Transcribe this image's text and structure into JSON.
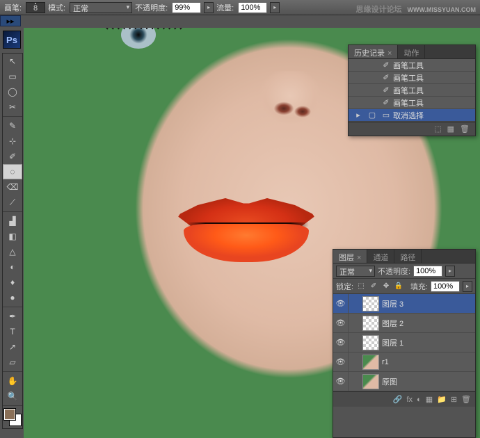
{
  "topbar": {
    "brush_label": "画笔:",
    "brush_size": "8",
    "mode_label": "模式:",
    "mode_value": "正常",
    "opacity_label": "不透明度:",
    "opacity_value": "99%",
    "flow_label": "流量:",
    "flow_value": "100%"
  },
  "watermark": {
    "main": "思缘设计论坛",
    "sub": "WWW.MISSYUAN.COM"
  },
  "ps_logo": "Ps",
  "tools": [
    "↖",
    "▭",
    "◯",
    "✂",
    "✎",
    "⊹",
    "✐",
    "◌",
    "⌫",
    "⟋",
    "▟",
    "◧",
    "△",
    "◐",
    "♦",
    "●",
    "✒",
    "T",
    "↗",
    "▱",
    "✋",
    "🔍"
  ],
  "selected_tool_index": 7,
  "swatch": {
    "fg": "#8a7058",
    "bg": "#ffffff"
  },
  "history": {
    "tabs": [
      "历史记录",
      "动作"
    ],
    "rows": [
      {
        "icon": "brush",
        "label": "画笔工具"
      },
      {
        "icon": "brush",
        "label": "画笔工具"
      },
      {
        "icon": "brush",
        "label": "画笔工具"
      },
      {
        "icon": "brush",
        "label": "画笔工具"
      },
      {
        "icon": "deselect",
        "label": "取消选择",
        "selected": true
      }
    ],
    "footer_icons": [
      "⬚",
      "▦",
      "🗑"
    ]
  },
  "layers": {
    "tabs": [
      "图层",
      "通道",
      "路径"
    ],
    "blend_mode": "正常",
    "opacity_label": "不透明度:",
    "opacity_value": "100%",
    "lock_label": "锁定:",
    "fill_label": "填充:",
    "fill_value": "100%",
    "rows": [
      {
        "name": "图层 3",
        "thumb": "checker",
        "selected": true
      },
      {
        "name": "图层 2",
        "thumb": "checker"
      },
      {
        "name": "图层 1",
        "thumb": "checker"
      },
      {
        "name": "r1",
        "thumb": "img"
      },
      {
        "name": "原图",
        "thumb": "img"
      }
    ],
    "footer_icons": [
      "🔗",
      "fx",
      "◐",
      "▦",
      "📁",
      "⊞",
      "🗑"
    ]
  }
}
